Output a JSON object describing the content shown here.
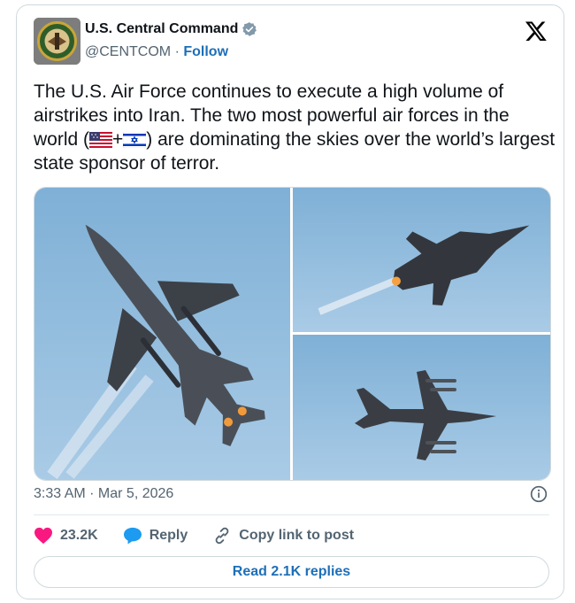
{
  "author": {
    "name": "U.S. Central Command",
    "handle": "@CENTCOM",
    "separator": "·",
    "follow_label": "Follow"
  },
  "tweet": {
    "text_part1": "The U.S. Air Force continues to execute a high volume of airstrikes into Iran. The two most powerful air forces in the world (",
    "plus": "+",
    "text_part2": ") are dominating the skies over the world’s largest state sponsor of terror."
  },
  "meta": {
    "timestamp": "3:33 AM · Mar 5, 2026"
  },
  "actions": {
    "likes": "23.2K",
    "reply_label": "Reply",
    "copy_label": "Copy link to post"
  },
  "footer": {
    "read_replies_label": "Read 2.1K replies"
  },
  "colors": {
    "like": "#f91880",
    "reply": "#1d9bf0",
    "link": "#1d6fb8",
    "verified": "#829aab"
  },
  "icons": [
    "x-logo-icon",
    "verified-badge-icon",
    "heart-icon",
    "reply-bubble-icon",
    "link-icon",
    "info-icon",
    "us-flag-emoji",
    "israel-flag-emoji"
  ]
}
